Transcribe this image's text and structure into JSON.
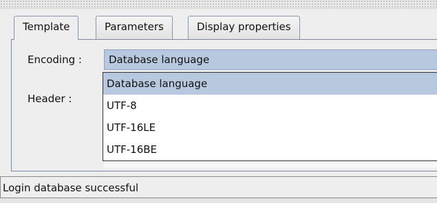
{
  "tabs": [
    {
      "label": "Template",
      "active": true
    },
    {
      "label": "Parameters",
      "active": false
    },
    {
      "label": "Display properties",
      "active": false
    }
  ],
  "form": {
    "encoding_label": "Encoding :",
    "encoding_value": "Database language",
    "header_label": "Header :"
  },
  "dropdown": {
    "options": [
      "Database language",
      "UTF-8",
      "UTF-16LE",
      "UTF-16BE"
    ],
    "selected": "Database language"
  },
  "status": {
    "message": "Login database successful"
  },
  "colors": {
    "selection": "#b8c9df",
    "tab_border": "#7a8aa6"
  }
}
